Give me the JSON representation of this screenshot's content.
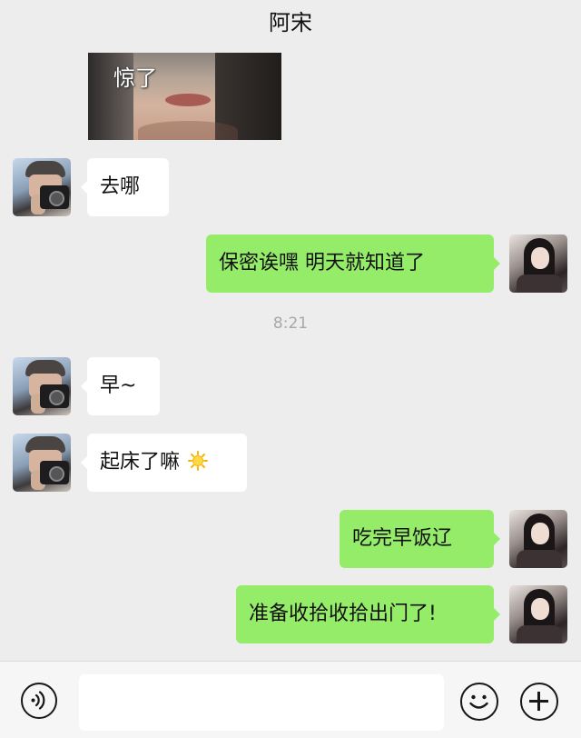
{
  "header": {
    "title": "阿宋"
  },
  "sticker": {
    "caption": "惊了"
  },
  "timestamp": "8:21",
  "messages": [
    {
      "side": "left",
      "text": "去哪"
    },
    {
      "side": "right",
      "text": "保密诶嘿  明天就知道了"
    },
    {
      "side": "left",
      "text": "早~"
    },
    {
      "side": "left",
      "text": "起床了嘛",
      "emoji": "sun-icon"
    },
    {
      "side": "right",
      "text": "吃完早饭辽"
    },
    {
      "side": "right",
      "text": "准备收拾收拾出门了!"
    }
  ],
  "input_bar": {
    "voice_icon": "voice-icon",
    "message_input_value": "",
    "emoji_icon": "smile-icon",
    "plus_icon": "plus-icon"
  },
  "colors": {
    "background": "#ededed",
    "bubble_sent": "#95ec69",
    "bubble_received": "#ffffff"
  }
}
